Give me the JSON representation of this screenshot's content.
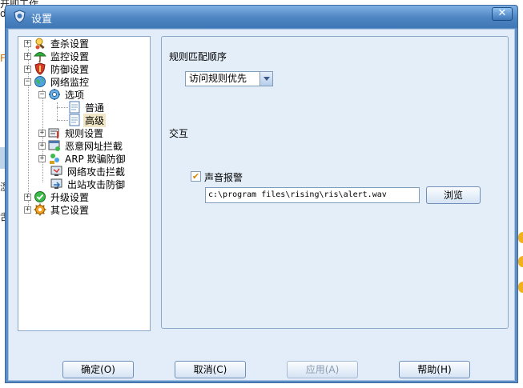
{
  "background": {
    "fragment_top": "开即工作",
    "fragment_d": "d",
    "fragment_f": "F",
    "fragment_side1": "湿",
    "fragment_side2": "舌"
  },
  "dialog": {
    "title": "设置",
    "close_glyph": "✕"
  },
  "tree": {
    "items": [
      {
        "label": "查杀设置",
        "icon": "search-virus-icon",
        "expander": "+"
      },
      {
        "label": "监控设置",
        "icon": "umbrella-icon",
        "expander": "+"
      },
      {
        "label": "防御设置",
        "icon": "shield-icon",
        "expander": "+"
      },
      {
        "label": "网络监控",
        "icon": "globe-icon",
        "expander": "−"
      },
      {
        "label": "选项",
        "icon": "gear-globe-icon",
        "expander": "−"
      },
      {
        "label": "普通",
        "icon": "document-icon"
      },
      {
        "label": "高级",
        "icon": "document-icon",
        "selected": true
      },
      {
        "label": "规则设置",
        "icon": "rules-icon",
        "expander": "+"
      },
      {
        "label": "恶意网址拦截",
        "icon": "url-block-icon",
        "expander": "+"
      },
      {
        "label": "ARP 欺骗防御",
        "icon": "arp-icon",
        "expander": "+"
      },
      {
        "label": "网络攻击拦截",
        "icon": "network-attack-icon"
      },
      {
        "label": "出站攻击防御",
        "icon": "outbound-icon"
      },
      {
        "label": "升级设置",
        "icon": "update-icon",
        "expander": "+"
      },
      {
        "label": "其它设置",
        "icon": "gear-icon",
        "expander": "+"
      }
    ]
  },
  "settings": {
    "rule_order_label": "规则匹配顺序",
    "rule_order_value": "访问规则优先",
    "interaction_label": "交互",
    "sound_alarm_label": "声音报警",
    "sound_alarm_checked": true,
    "sound_path": "c:\\program files\\rising\\ris\\alert.wav",
    "browse_label": "浏览"
  },
  "buttons": {
    "ok": "确定(O)",
    "cancel": "取消(C)",
    "apply": "应用(A)",
    "help": "帮助(H)"
  },
  "colors": {
    "accent": "#4d84c2",
    "selection": "#f1e7c6",
    "check": "#d18a00"
  }
}
